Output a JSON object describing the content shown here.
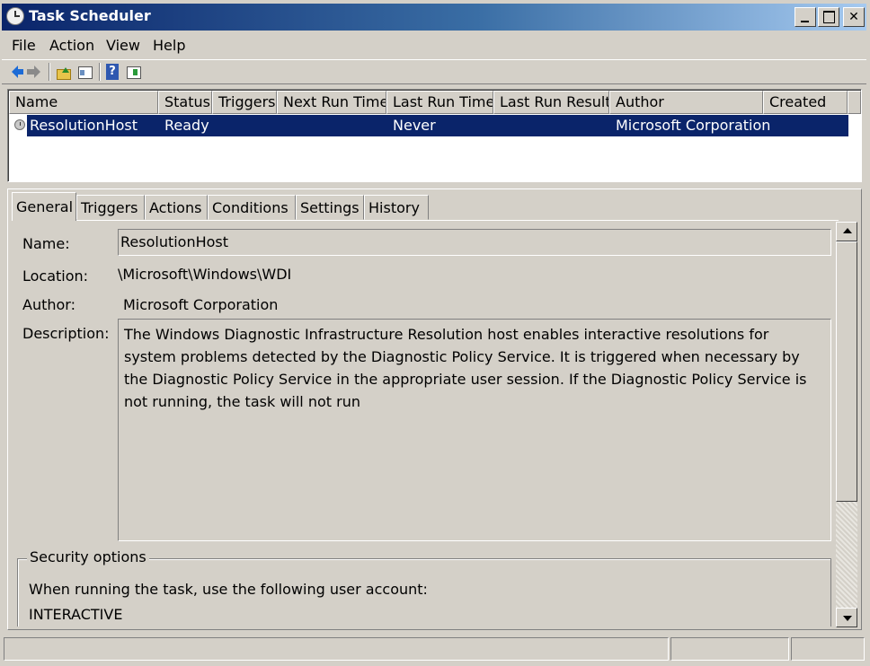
{
  "window": {
    "title": "Task Scheduler"
  },
  "menu": {
    "items": [
      "File",
      "Action",
      "View",
      "Help"
    ]
  },
  "toolbar": {
    "icons": [
      "back-arrow-icon",
      "forward-arrow-icon",
      "folder-up-icon",
      "show-tree-icon",
      "help-icon",
      "properties-icon"
    ],
    "help_glyph": "?"
  },
  "tasklist": {
    "columns": [
      "Name",
      "Status",
      "Triggers",
      "Next Run Time",
      "Last Run Time",
      "Last Run Result",
      "Author",
      "Created"
    ],
    "rows": [
      {
        "name": "ResolutionHost",
        "status": "Ready",
        "triggers": "",
        "next_run": "",
        "last_run": "Never",
        "last_result": "",
        "author": "Microsoft Corporation",
        "created": ""
      }
    ],
    "selected_row": 0
  },
  "tabs": {
    "items": [
      "General",
      "Triggers",
      "Actions",
      "Conditions",
      "Settings",
      "History"
    ],
    "active": "General"
  },
  "general": {
    "name_label": "Name:",
    "name_value": "ResolutionHost",
    "location_label": "Location:",
    "location_value": "\\Microsoft\\Windows\\WDI",
    "author_label": "Author:",
    "author_value": "Microsoft Corporation",
    "description_label": "Description:",
    "description_value": "The Windows Diagnostic Infrastructure Resolution host enables interactive resolutions for system problems detected by the Diagnostic Policy Service. It is triggered when necessary by the Diagnostic Policy Service in the appropriate user session. If the Diagnostic Policy Service is not running, the task will not run",
    "security": {
      "title": "Security options",
      "user_account_text": "When running the task, use the following user account:",
      "user_account_value": "INTERACTIVE"
    }
  },
  "colors": {
    "selection": "#0a246a",
    "face": "#d4d0c8",
    "title_start": "#0a246a",
    "title_end": "#a6caf0"
  }
}
